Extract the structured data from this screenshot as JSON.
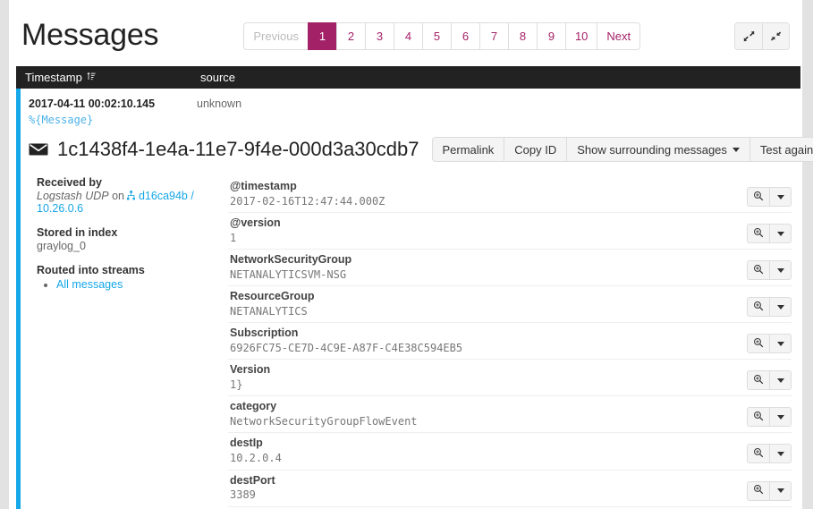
{
  "header": {
    "title": "Messages",
    "expand_icon": "expand-arrows-icon",
    "collapse_icon": "collapse-arrows-icon"
  },
  "pagination": {
    "previous_label": "Previous",
    "next_label": "Next",
    "pages": [
      "1",
      "2",
      "3",
      "4",
      "5",
      "6",
      "7",
      "8",
      "9",
      "10"
    ],
    "active_page": "1",
    "active_color": "#a32167"
  },
  "table": {
    "columns": [
      {
        "label": "Timestamp",
        "sort_icon": "sort-amount-icon"
      },
      {
        "label": "source",
        "sort_icon": ""
      }
    ]
  },
  "message": {
    "accent_color": "#16a7e8",
    "timestamp": "2017-04-11 00:02:10.145",
    "source": "unknown",
    "preview": "%{Message}",
    "id": "1c1438f4-1e4a-11e7-9f4e-000d3a30cdb7",
    "id_icon": "envelope-icon",
    "actions": [
      {
        "label": "Permalink",
        "caret": false
      },
      {
        "label": "Copy ID",
        "caret": false
      },
      {
        "label": "Show surrounding messages",
        "caret": true
      },
      {
        "label": "Test against stream",
        "caret": true
      }
    ]
  },
  "meta": {
    "received_by": {
      "title": "Received by",
      "input": "Logstash UDP",
      "on": "on",
      "node_icon": "sitemap-icon",
      "node": "d16ca94b",
      "separator": "/",
      "ip": "10.26.0.6"
    },
    "stored_in_index": {
      "title": "Stored in index",
      "value": "graylog_0"
    },
    "routed_into_streams": {
      "title": "Routed into streams",
      "streams": [
        "All messages"
      ]
    }
  },
  "fields": {
    "search_icon": "search-plus-icon",
    "dropdown_icon": "caret-down-icon",
    "rows": [
      {
        "name": "@timestamp",
        "value": "2017-02-16T12:47:44.000Z"
      },
      {
        "name": "@version",
        "value": "1"
      },
      {
        "name": "NetworkSecurityGroup",
        "value": "NETANALYTICSVM-NSG"
      },
      {
        "name": "ResourceGroup",
        "value": "NETANALYTICS"
      },
      {
        "name": "Subscription",
        "value": "6926FC75-CE7D-4C9E-A87F-C4E38C594EB5"
      },
      {
        "name": "Version",
        "value": "1}"
      },
      {
        "name": "category",
        "value": "NetworkSecurityGroupFlowEvent"
      },
      {
        "name": "destIp",
        "value": "10.2.0.4"
      },
      {
        "name": "destPort",
        "value": "3389"
      }
    ]
  }
}
